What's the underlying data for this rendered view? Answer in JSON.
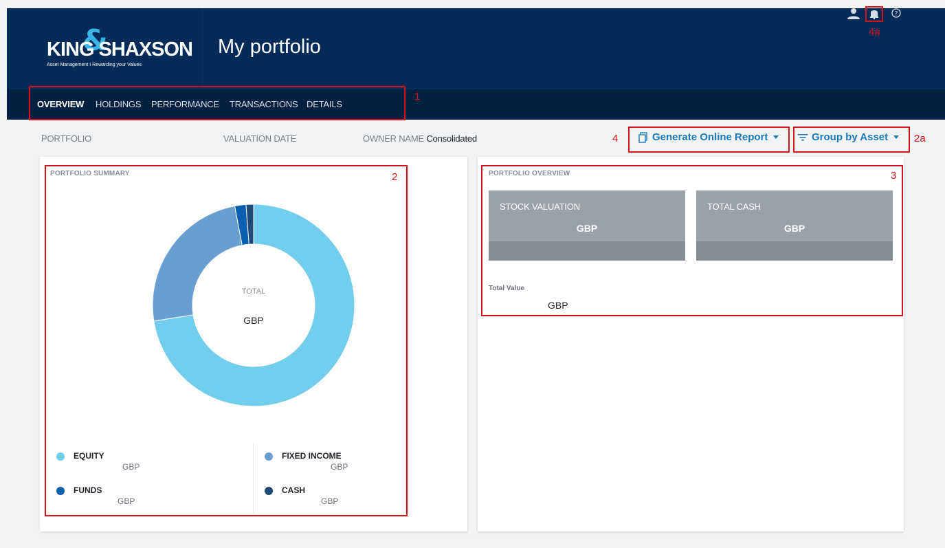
{
  "header": {
    "logo_text": "KING SHAXSON",
    "logo_amp": "&",
    "logo_tagline": "Asset Management I Rewarding your Values",
    "page_title": "My portfolio",
    "icons": [
      "user-icon",
      "bell-icon",
      "help-icon"
    ]
  },
  "nav": {
    "items": [
      {
        "label": "OVERVIEW",
        "active": true
      },
      {
        "label": "HOLDINGS",
        "active": false
      },
      {
        "label": "PERFORMANCE",
        "active": false
      },
      {
        "label": "TRANSACTIONS",
        "active": false
      },
      {
        "label": "DETAILS",
        "active": false
      }
    ]
  },
  "meta": {
    "portfolio_label": "PORTFOLIO",
    "valuation_date_label": "VALUATION DATE",
    "owner_name_label": "OWNER NAME",
    "owner_name_value": "Consolidated"
  },
  "actions": {
    "generate_report": "Generate Online Report",
    "group_by": "Group by Asset"
  },
  "annotations": {
    "a1": "1",
    "a2": "2",
    "a2a": "2a",
    "a3": "3",
    "a4": "4",
    "a4a": "4a"
  },
  "summary": {
    "title": "PORTFOLIO SUMMARY",
    "center_label": "TOTAL",
    "center_value": "GBP",
    "legend": [
      {
        "name": "EQUITY",
        "value": "GBP",
        "color": "#72cdec"
      },
      {
        "name": "FIXED INCOME",
        "value": "GBP",
        "color": "#699fd0"
      },
      {
        "name": "FUNDS",
        "value": "GBP",
        "color": "#0b5fb0"
      },
      {
        "name": "CASH",
        "value": "GBP",
        "color": "#1e4a75"
      }
    ]
  },
  "chart_data": {
    "type": "pie",
    "categories": [
      "EQUITY",
      "FIXED INCOME",
      "FUNDS",
      "CASH"
    ],
    "values": [
      72.5,
      24.5,
      1.8,
      1.2
    ],
    "colors": [
      "#72cdec",
      "#699fd0",
      "#0b5fb0",
      "#1e4a75"
    ],
    "title": "PORTFOLIO SUMMARY",
    "donut": true
  },
  "overview": {
    "title": "PORTFOLIO OVERVIEW",
    "tiles": [
      {
        "label": "STOCK VALUATION",
        "value": "GBP"
      },
      {
        "label": "TOTAL CASH",
        "value": "GBP"
      }
    ],
    "total_value_label": "Total Value",
    "total_value": "GBP"
  },
  "colors": {
    "header_bg": "#032b57",
    "nav_bg": "#02203f",
    "accent": "#1979b8",
    "annotation_red": "#d3121a"
  }
}
